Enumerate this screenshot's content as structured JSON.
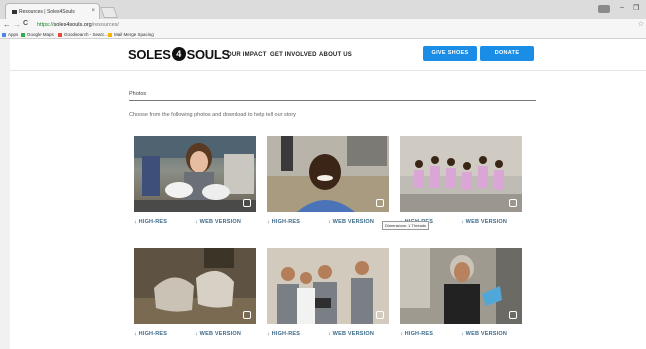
{
  "browser": {
    "tab_title": "Resources | Soles4Souls",
    "tab_close": "×",
    "url_https": "https://",
    "url_host": "soles4souls.org",
    "url_path": "/resources/",
    "back": "←",
    "forward": "→",
    "reload": "C",
    "star": "☆",
    "minimize": "–",
    "restore": "❐",
    "bookmarks": [
      {
        "label": "Apps",
        "color": "#4a86e8"
      },
      {
        "label": "Google Maps",
        "color": "#34a853"
      },
      {
        "label": "Goodsearch - Searc...",
        "color": "#e94e3c"
      },
      {
        "label": "Mail Merge Spacing",
        "color": "#f5b400"
      }
    ]
  },
  "site": {
    "logo_left": "SOLES",
    "logo_mid": "4",
    "logo_right": "SOULS",
    "nav": [
      "OUR IMPACT",
      "GET INVOLVED",
      "ABOUT US"
    ],
    "give_shoes": "GIVE SHOES",
    "donate": "DONATE",
    "accent": "#1a8ee6"
  },
  "main": {
    "section_title": "Photos",
    "intro": "Choose from the following photos and download to help tell our story",
    "high_res": "↓ HIGH-RES",
    "web_version": "↓ WEB VERSION",
    "photos": [
      {
        "subject": "girl-with-sneakers"
      },
      {
        "subject": "smiling-boy"
      },
      {
        "subject": "dancing-girls"
      },
      {
        "subject": "worn-shoes"
      },
      {
        "subject": "volunteers-group"
      },
      {
        "subject": "woman-with-shoes"
      }
    ],
    "tooltip": "Dimensions: 1 Threads"
  }
}
